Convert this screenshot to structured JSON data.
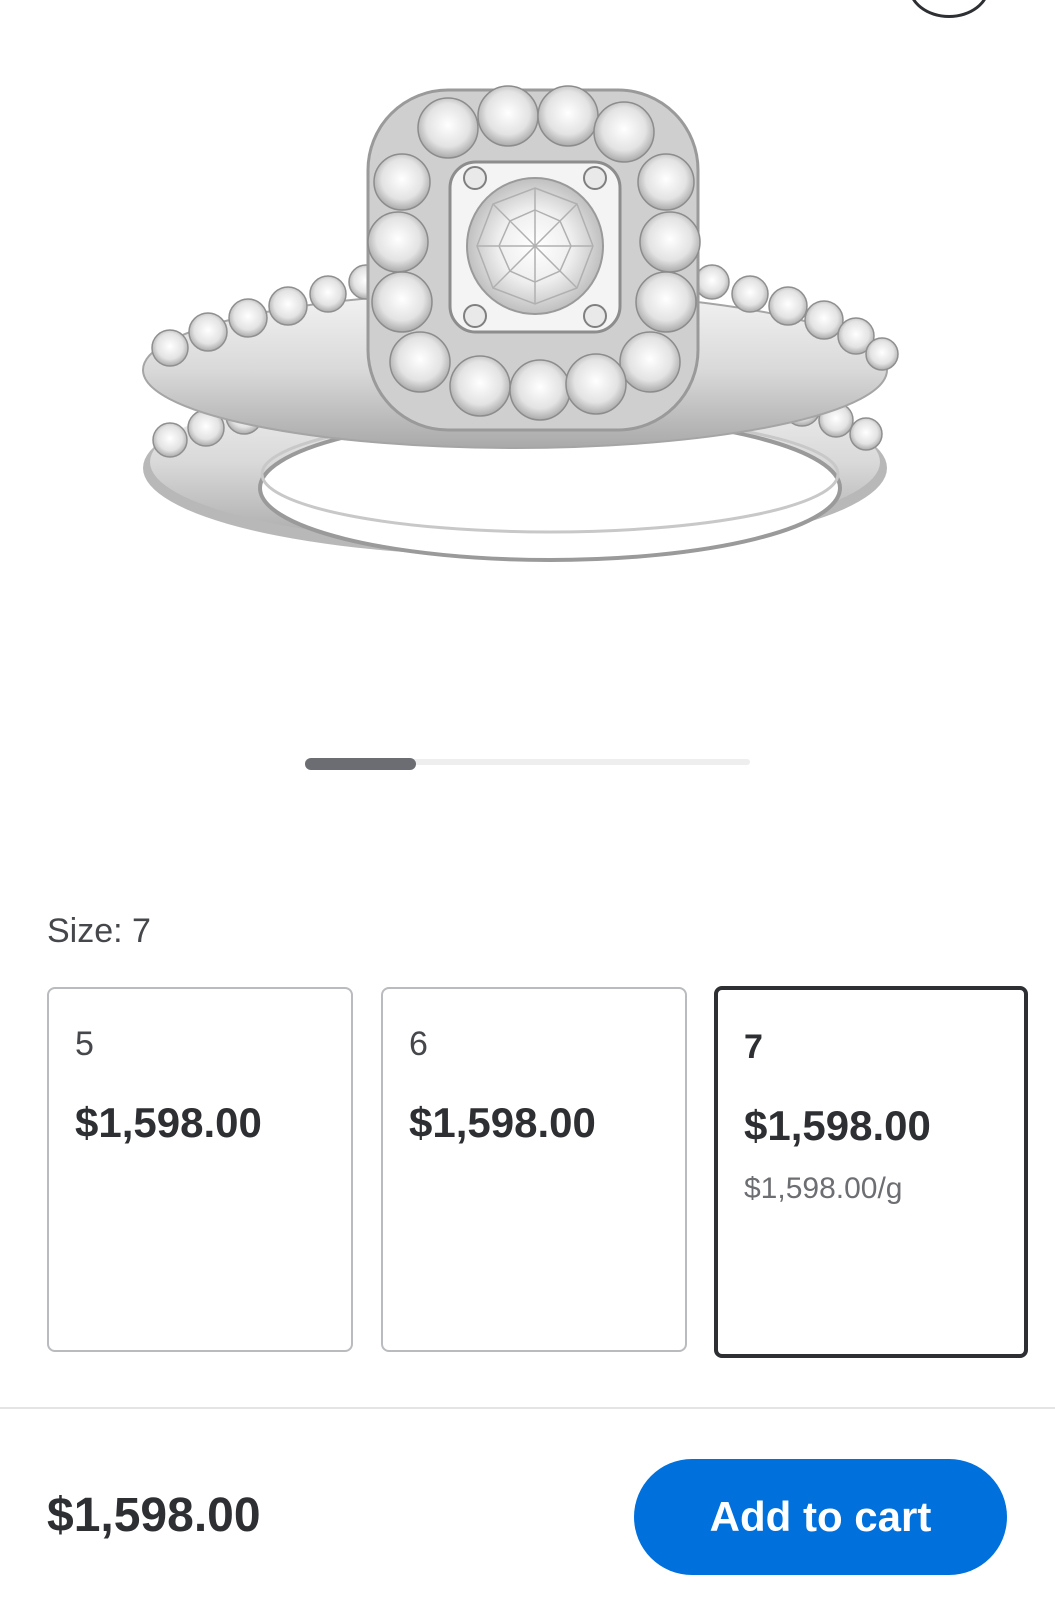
{
  "product": {
    "image_alt": "Halo diamond engagement ring and matching wedding band bridal set in white gold"
  },
  "carousel": {
    "current": 1,
    "total": 4
  },
  "size_selector": {
    "label": "Size: 7",
    "selected_size": "7",
    "options": [
      {
        "size": "5",
        "price": "$1,598.00",
        "unit_price": "",
        "selected": false
      },
      {
        "size": "6",
        "price": "$1,598.00",
        "unit_price": "",
        "selected": false
      },
      {
        "size": "7",
        "price": "$1,598.00",
        "unit_price": "$1,598.00/g",
        "selected": true
      }
    ]
  },
  "footer": {
    "price": "$1,598.00",
    "add_to_cart_label": "Add to cart"
  },
  "colors": {
    "accent": "#0071dc",
    "text": "#2e2f32",
    "selected_border": "#2e2f32",
    "card_border": "#babbbe"
  }
}
